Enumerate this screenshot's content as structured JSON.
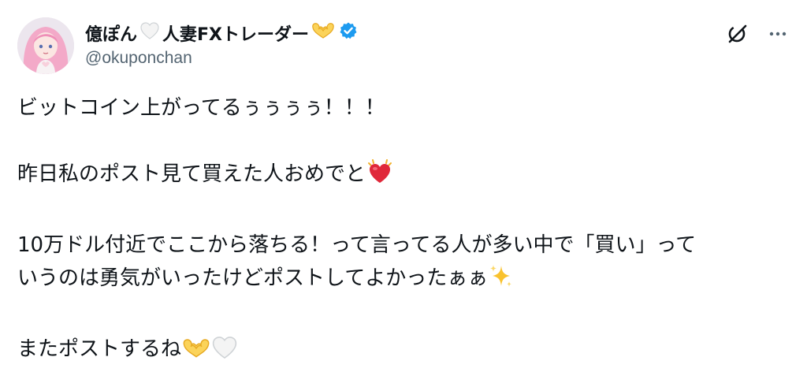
{
  "author": {
    "name_part1": "億ぽん",
    "name_part2": "人妻FXトレーダー",
    "handle": "@okuponchan",
    "verified": true,
    "avatar_icon": "avatar-icon"
  },
  "icons": {
    "white_heart": "white-heart-icon",
    "heart_hands": "heart-hands-icon",
    "verified_badge": "verified-badge-icon",
    "grok": "grok-icon",
    "more": "more-icon",
    "beating_heart": "beating-heart-icon",
    "sparkles": "sparkles-icon"
  },
  "colors": {
    "verified_blue": "#1d9bf0",
    "text": "#0f1419",
    "handle_gray": "#536471",
    "heart_red": "#e0283a",
    "heart_hands_yellow": "#f7c948",
    "sparkle_yellow": "#f9c22e"
  },
  "post": {
    "line1": "ビットコイン上がってるぅぅぅぅ！！！",
    "line2": "昨日私のポスト見て買えた人おめでと",
    "line3": "10万ドル付近でここから落ちる！って言ってる人が多い中で「買い」って",
    "line4": "いうのは勇気がいったけどポストしてよかったぁぁ",
    "line5": "またポストするね"
  }
}
